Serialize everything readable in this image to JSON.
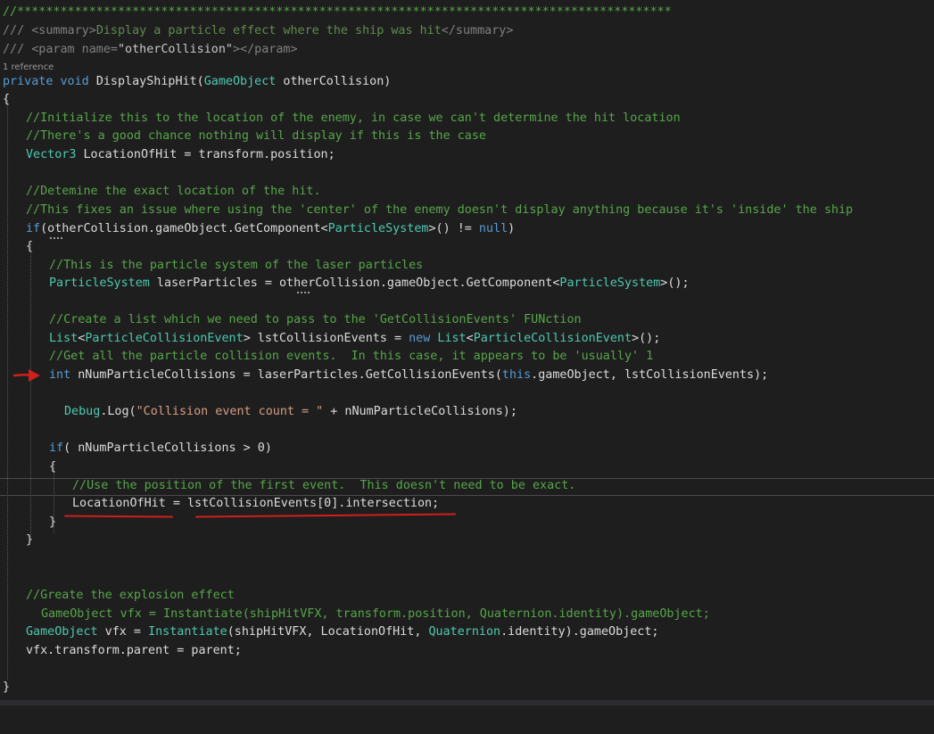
{
  "editor": {
    "reference_lens": "1 reference",
    "lines": {
      "l1": "//*******************************************************************************************",
      "l2a": "/// ",
      "l2b": "<summary>",
      "l2c": "Display a particle effect where the ship was hit",
      "l2d": "</summary>",
      "l3a": "/// ",
      "l3b": "<param name=",
      "l3c": "\"otherCollision\"",
      "l3d": "></param>",
      "l4_kw1": "private",
      "l4_kw2": "void",
      "l4_name": "DisplayShipHit(",
      "l4_type": "GameObject",
      "l4_rest": " otherCollision)",
      "l5": "{",
      "l6": "//Initialize this to the location of the enemy, in case we can't determine the hit location",
      "l7": "//There's a good chance nothing will display if this is the case",
      "l8_type": "Vector3",
      "l8_rest": " LocationOfHit = transform.position;",
      "l10": "//Detemine the exact location of the hit.",
      "l11": "//This fixes an issue where using the 'center' of the enemy doesn't display anything because it's 'inside' the ship",
      "l12_kw": "if",
      "l12_a": "(otherCollision.gameObject.GetComponent<",
      "l12_type": "ParticleSystem",
      "l12_b": ">() != ",
      "l12_null": "null",
      "l12_c": ")",
      "l13": "{",
      "l14": "//This is the particle system of the laser particles",
      "l15_type": "ParticleSystem",
      "l15_a": " laserParticles = otherCollision.gameObject.GetComponent<",
      "l15_type2": "ParticleSystem",
      "l15_b": ">();",
      "l17": "//Create a list which we need to pass to the 'GetCollisionEvents' FUNction",
      "l18_type": "List",
      "l18_a": "<",
      "l18_type2": "ParticleCollisionEvent",
      "l18_b": "> lstCollisionEvents = ",
      "l18_kw": "new",
      "l18_type3": "List",
      "l18_c": "<",
      "l18_type4": "ParticleCollisionEvent",
      "l18_d": ">();",
      "l19": "//Get all the particle collision events.  In this case, it appears to be 'usually' 1",
      "l20_kw": "int",
      "l20_a": " nNumParticleCollisions = laserParticles.GetCollisionEvents(",
      "l20_kw2": "this",
      "l20_b": ".gameObject, lstCollisionEvents);",
      "l22_type": "Debug",
      "l22_a": ".Log(",
      "l22_str": "\"Collision event count = \"",
      "l22_b": " + nNumParticleCollisions);",
      "l24_kw": "if",
      "l24_a": "( nNumParticleCollisions > 0)",
      "l25": "{",
      "l26": "//Use the position of the first event.  This doesn't need to be exact.",
      "l27": "LocationOfHit = lstCollisionEvents[0].intersection;",
      "l28": "}",
      "l29": "}",
      "l32": "//Greate the explosion effect",
      "l33": "GameObject vfx = Instantiate(shipHitVFX, transform.position, Quaternion.identity).gameObject;",
      "l34_type": "GameObject",
      "l34_a": " vfx = ",
      "l34_b": "Instantiate",
      "l34_c": "(shipHitVFX, LocationOfHit, ",
      "l34_d": "Quaternion",
      "l34_e": ".identity).gameObject;",
      "l35": "vfx.transform.parent = parent;",
      "l37": "}"
    }
  },
  "colors": {
    "background": "#1e1e1e",
    "comment": "#57a64a",
    "keyword": "#569cd6",
    "type": "#4ec9b0",
    "string": "#d69d85",
    "annotation_red": "#d0201c"
  },
  "annotations": {
    "arrow_icon": "red-arrow-icon",
    "underline_color": "red"
  }
}
